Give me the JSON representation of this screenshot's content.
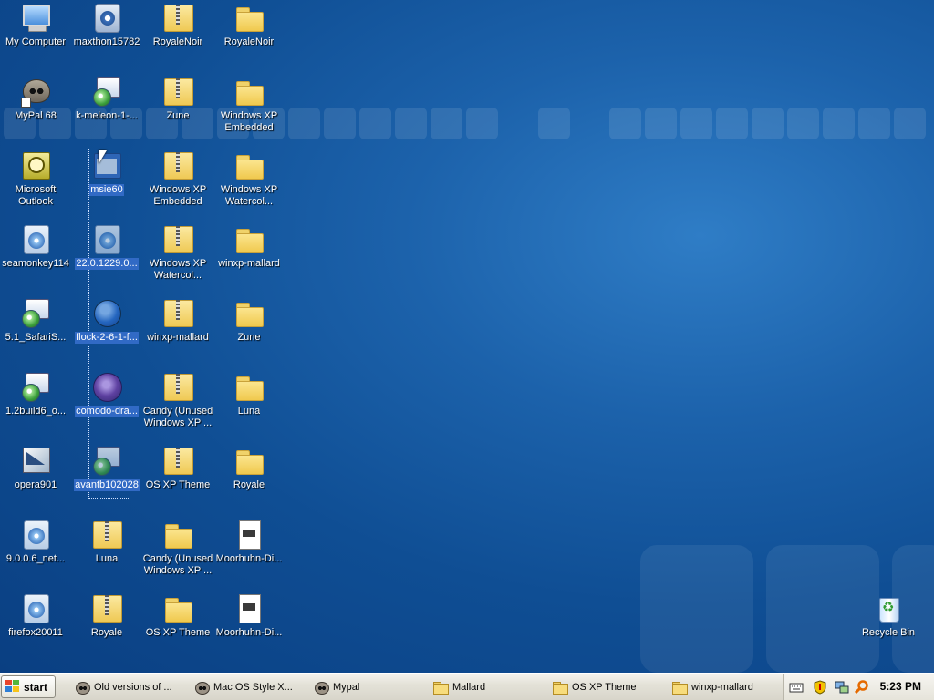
{
  "desktop": {
    "icons": [
      {
        "label": "My Computer",
        "icon": "computer-icon"
      },
      {
        "label": "maxthon15782",
        "icon": "maxthon-installer-icon"
      },
      {
        "label": "RoyaleNoir",
        "icon": "zip-folder-icon"
      },
      {
        "label": "RoyaleNoir",
        "icon": "folder-icon"
      },
      {
        "label": "MyPal 68",
        "icon": "mypal-shortcut-icon"
      },
      {
        "label": "k-meleon-1-...",
        "icon": "setup-installer-icon"
      },
      {
        "label": "Zune",
        "icon": "zip-folder-icon"
      },
      {
        "label": "Windows XP Embedded",
        "icon": "folder-icon"
      },
      {
        "label": "Microsoft Outlook",
        "icon": "outlook-icon"
      },
      {
        "label": "msie60",
        "icon": "application-window-icon"
      },
      {
        "label": "Windows XP Embedded",
        "icon": "zip-folder-icon"
      },
      {
        "label": "Windows XP Watercol...",
        "icon": "folder-icon"
      },
      {
        "label": "seamonkey114",
        "icon": "cd-setup-icon"
      },
      {
        "label": "22.0.1229.0...",
        "icon": "cd-setup-icon"
      },
      {
        "label": "Windows XP Watercol...",
        "icon": "zip-folder-icon"
      },
      {
        "label": "winxp-mallard",
        "icon": "folder-icon"
      },
      {
        "label": "5.1_SafariS...",
        "icon": "setup-installer-icon"
      },
      {
        "label": "flock-2-6-1-f...",
        "icon": "flock-installer-icon"
      },
      {
        "label": "winxp-mallard",
        "icon": "zip-folder-icon"
      },
      {
        "label": "Zune",
        "icon": "folder-icon"
      },
      {
        "label": "1.2build6_o...",
        "icon": "setup-installer-icon"
      },
      {
        "label": "comodo-dra...",
        "icon": "comodo-dragon-icon"
      },
      {
        "label": "Candy (Unused Windows XP ...",
        "icon": "zip-folder-icon"
      },
      {
        "label": "Luna",
        "icon": "folder-icon"
      },
      {
        "label": "opera901",
        "icon": "opera-installer-icon"
      },
      {
        "label": "avantb102028",
        "icon": "setup-installer-icon"
      },
      {
        "label": "OS XP Theme",
        "icon": "zip-folder-icon"
      },
      {
        "label": "Royale",
        "icon": "folder-icon"
      },
      {
        "label": "9.0.0.6_net...",
        "icon": "cd-setup-icon"
      },
      {
        "label": "Luna",
        "icon": "zip-folder-icon"
      },
      {
        "label": "Candy (Unused Windows XP ...",
        "icon": "folder-icon"
      },
      {
        "label": "Moorhuhn-Di...",
        "icon": "document-icon"
      },
      {
        "label": "firefox20011",
        "icon": "cd-setup-icon"
      },
      {
        "label": "Royale",
        "icon": "zip-folder-icon"
      },
      {
        "label": "OS XP Theme",
        "icon": "folder-icon"
      },
      {
        "label": "Moorhuhn-Di...",
        "icon": "document-icon"
      },
      {
        "label": "Recycle Bin",
        "icon": "recycle-bin-icon"
      }
    ]
  },
  "taskbar": {
    "start_label": "start",
    "tasks": [
      {
        "label": "Old versions of ...",
        "icon": "mypal-icon"
      },
      {
        "label": "Mac OS Style X...",
        "icon": "mypal-icon"
      },
      {
        "label": "Mypal",
        "icon": "mypal-icon"
      },
      {
        "label": "Mallard",
        "icon": "folder-icon"
      },
      {
        "label": "OS XP Theme",
        "icon": "folder-icon"
      },
      {
        "label": "winxp-mallard",
        "icon": "folder-icon"
      }
    ],
    "tray": {
      "icons": [
        "keyboard-icon",
        "security-shield-icon",
        "network-icon",
        "search-icon"
      ],
      "clock": "5:23 PM"
    }
  },
  "colors": {
    "desktop_blue": "#1c62ab",
    "selection_blue": "#316ac5",
    "taskbar_bg": "#e4e2d8"
  }
}
